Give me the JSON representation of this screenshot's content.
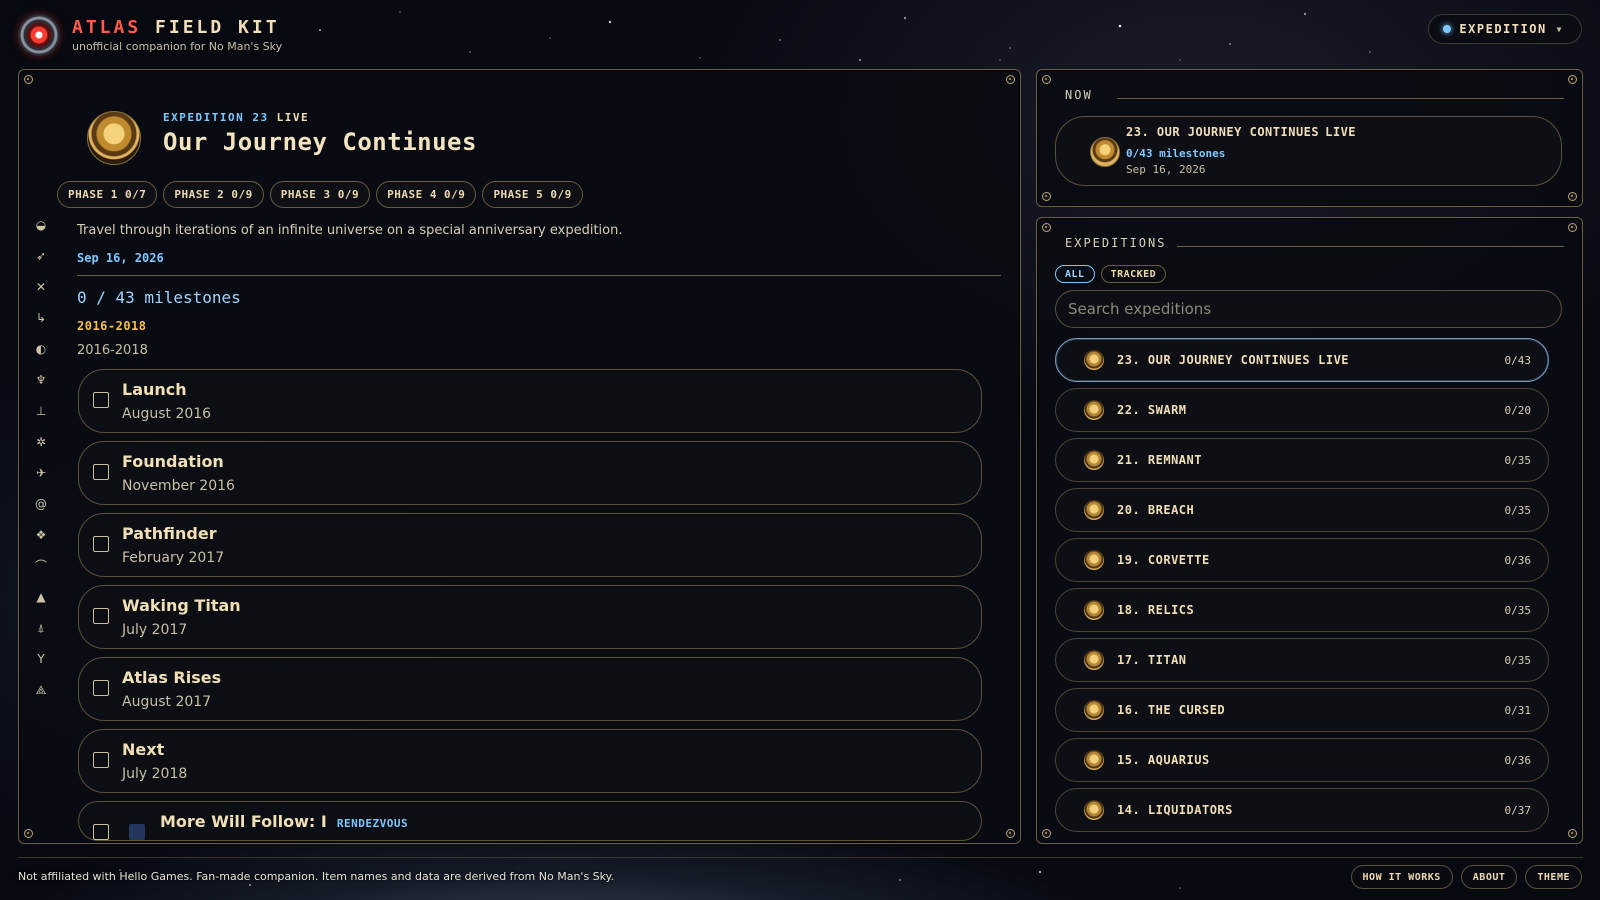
{
  "brand": {
    "title_accent": "ATLAS",
    "title_rest": "FIELD KIT",
    "subtitle": "unofficial companion for No Man's Sky"
  },
  "top_button": {
    "label": "EXPEDITION"
  },
  "rail_icons": [
    "ship-icon",
    "fighter-icon",
    "explorer-icon",
    "hauler-icon",
    "planet-icon",
    "freighter-icon",
    "station-icon",
    "sentinel-icon",
    "jet-icon",
    "vortex-icon",
    "cube-icon",
    "bird-icon",
    "rocket-icon",
    "interceptor-icon",
    "solar-icon",
    "pyramid-icon"
  ],
  "hero": {
    "kicker": "EXPEDITION 23",
    "live": "LIVE",
    "title": "Our Journey Continues",
    "phases": [
      "PHASE 1 0/7",
      "PHASE 2 0/9",
      "PHASE 3 0/9",
      "PHASE 4 0/9",
      "PHASE 5 0/9"
    ],
    "description": "Travel through iterations of an infinite universe on a special anniversary expedition.",
    "date": "Sep 16, 2026",
    "progress": "0 / 43 milestones",
    "era_heading": "2016-2018",
    "era_sub": "2016-2018"
  },
  "milestones": [
    {
      "name": "Launch",
      "date": "August 2016"
    },
    {
      "name": "Foundation",
      "date": "November 2016"
    },
    {
      "name": "Pathfinder",
      "date": "February 2017"
    },
    {
      "name": "Waking Titan",
      "date": "July 2017"
    },
    {
      "name": "Atlas Rises",
      "date": "August 2017"
    },
    {
      "name": "Next",
      "date": "July 2018"
    }
  ],
  "partial_milestone": {
    "name": "More Will Follow: I",
    "tag": "RENDEZVOUS"
  },
  "now": {
    "label": "NOW",
    "title": "23. OUR JOURNEY CONTINUES",
    "live": "LIVE",
    "count": "0/43 milestones",
    "date": "Sep 16, 2026"
  },
  "expeditions": {
    "label": "EXPEDITIONS",
    "filters": [
      "ALL",
      "TRACKED"
    ],
    "search_placeholder": "Search expeditions",
    "items": [
      {
        "name": "23. OUR JOURNEY CONTINUES",
        "live": "LIVE",
        "count": "0/43"
      },
      {
        "name": "22. SWARM",
        "count": "0/20"
      },
      {
        "name": "21. REMNANT",
        "count": "0/35"
      },
      {
        "name": "20. BREACH",
        "count": "0/35"
      },
      {
        "name": "19. CORVETTE",
        "count": "0/36"
      },
      {
        "name": "18. RELICS",
        "count": "0/35"
      },
      {
        "name": "17. TITAN",
        "count": "0/35"
      },
      {
        "name": "16. THE CURSED",
        "count": "0/31"
      },
      {
        "name": "15. AQUARIUS",
        "count": "0/36"
      },
      {
        "name": "14. LIQUIDATORS",
        "count": "0/37"
      }
    ]
  },
  "footer": {
    "note": "Not affiliated with Hello Games. Fan-made companion. Item names and data are derived from No Man's Sky.",
    "buttons": [
      "HOW IT WORKS",
      "ABOUT",
      "THEME"
    ]
  },
  "colors": {
    "accent_blue": "#7ec8ff",
    "gold": "#f5c04a",
    "brand_red": "#ff5a4a",
    "panel_border": "#6f5f3f"
  }
}
